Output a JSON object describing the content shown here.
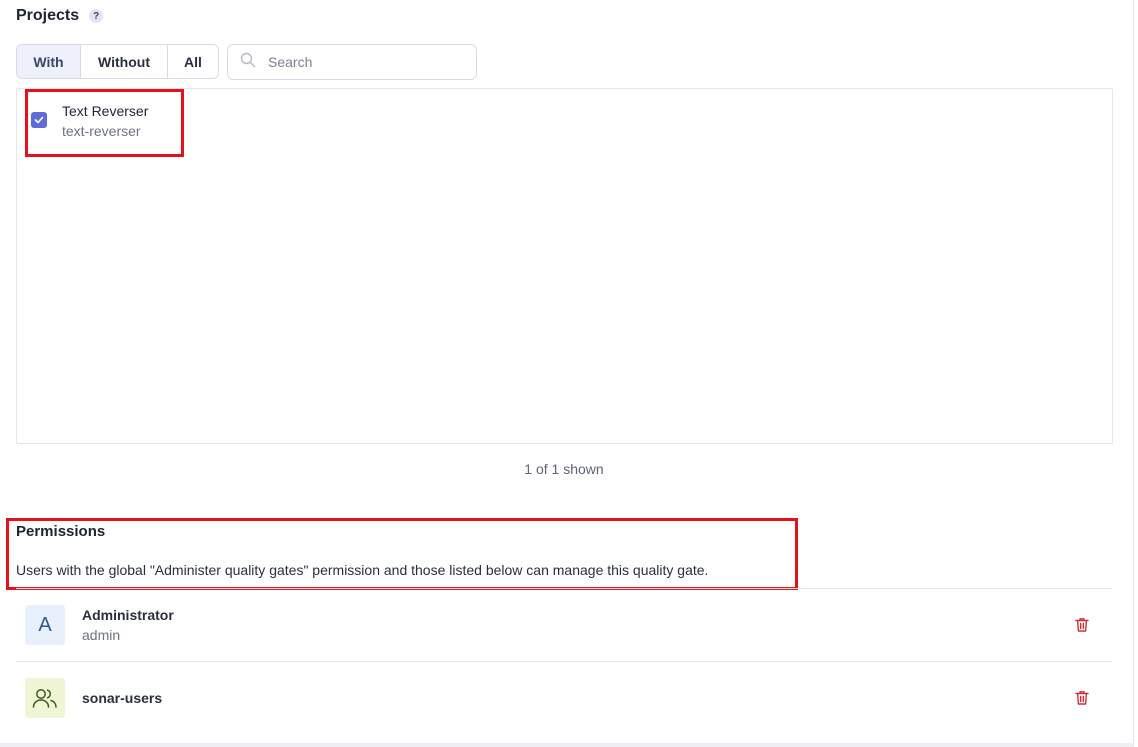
{
  "projects": {
    "title": "Projects",
    "help_icon": "?",
    "filters": [
      {
        "label": "With",
        "selected": true
      },
      {
        "label": "Without",
        "selected": false
      },
      {
        "label": "All",
        "selected": false
      }
    ],
    "search": {
      "placeholder": "Search",
      "value": ""
    },
    "items": [
      {
        "name": "Text Reverser",
        "key": "text-reverser",
        "checked": true
      }
    ],
    "shown_count": "1 of 1 shown"
  },
  "permissions": {
    "title": "Permissions",
    "description": "Users with the global \"Administer quality gates\" permission and those listed below can manage this quality gate.",
    "entries": [
      {
        "type": "user",
        "avatar_letter": "A",
        "name": "Administrator",
        "login": "admin",
        "icon": "trash-icon"
      },
      {
        "type": "group",
        "name": "sonar-users",
        "icon": "trash-icon"
      }
    ]
  },
  "colors": {
    "accent": "#5f6bd6",
    "highlight": "#e3121b",
    "delete": "#d02f3a"
  }
}
